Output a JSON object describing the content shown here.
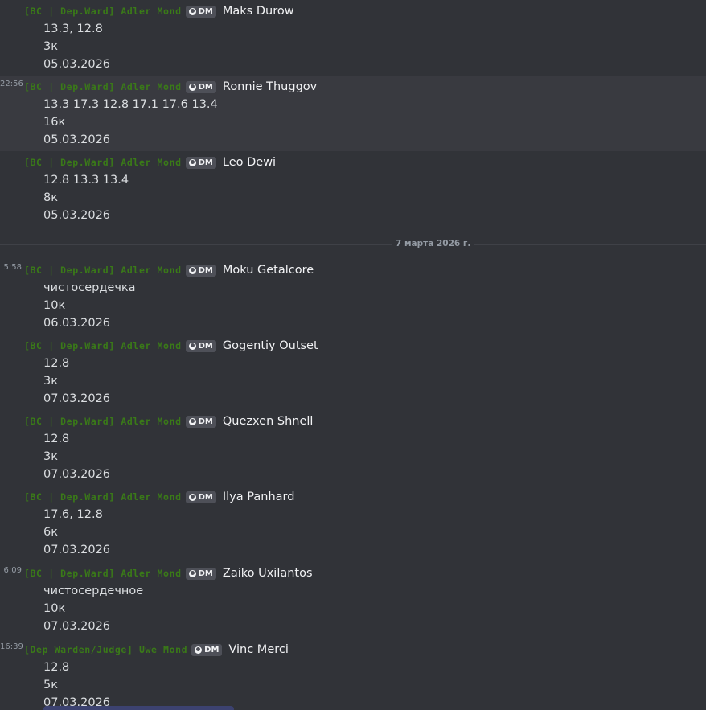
{
  "colors": {
    "background": "#313338",
    "highlight": "#393a40",
    "role_tag": "#3a7a18",
    "username": "#f2f3f5",
    "message_text": "#dbdee1",
    "muted": "#949ba4"
  },
  "badge_icon": "profile-icon",
  "date_divider": "7 марта 2026 г.",
  "messages": [
    {
      "time": "",
      "tag": "[BC | Dep.Ward] Adler Mond",
      "badge": "DM",
      "user": "Maks Durow",
      "lines": [
        "13.3, 12.8",
        "3к",
        "05.03.2026"
      ]
    },
    {
      "time": "22:56",
      "tag": "[BC | Dep.Ward] Adler Mond",
      "badge": "DM",
      "user": "Ronnie Thuggov",
      "lines": [
        "13.3 17.3 12.8 17.1 17.6 13.4",
        "16к",
        "05.03.2026"
      ]
    },
    {
      "time": "",
      "tag": "[BC | Dep.Ward] Adler Mond",
      "badge": "DM",
      "user": "Leo Dewi",
      "lines": [
        "12.8 13.3 13.4",
        "8к",
        "05.03.2026"
      ]
    },
    {
      "time": "5:58",
      "tag": "[BC | Dep.Ward] Adler Mond",
      "badge": "DM",
      "user": "Moku Getalcore",
      "lines": [
        "чистосердечка",
        "10к",
        "06.03.2026"
      ]
    },
    {
      "time": "",
      "tag": "[BC | Dep.Ward] Adler Mond",
      "badge": "DM",
      "user": "Gogentiy Outset",
      "lines": [
        "12.8",
        "3к",
        "07.03.2026"
      ]
    },
    {
      "time": "",
      "tag": "[BC | Dep.Ward] Adler Mond",
      "badge": "DM",
      "user": "Quezxen Shnell",
      "lines": [
        "12.8",
        "3к",
        "07.03.2026"
      ]
    },
    {
      "time": "",
      "tag": "[BC | Dep.Ward] Adler Mond",
      "badge": "DM",
      "user": "Ilya Panhard",
      "lines": [
        "17.6, 12.8",
        "6к",
        "07.03.2026"
      ]
    },
    {
      "time": "6:09",
      "tag": "[BC | Dep.Ward] Adler Mond",
      "badge": "DM",
      "user": "Zaiko Uxilantos",
      "lines": [
        "чистосердечное",
        "10к",
        "07.03.2026"
      ]
    },
    {
      "time": "16:39",
      "tag": "[Dep Warden/Judge] Uwe Mond",
      "badge": "DM",
      "user": "Vinc Merci",
      "lines": [
        "12.8",
        "5к",
        "07.03.2026"
      ]
    }
  ]
}
